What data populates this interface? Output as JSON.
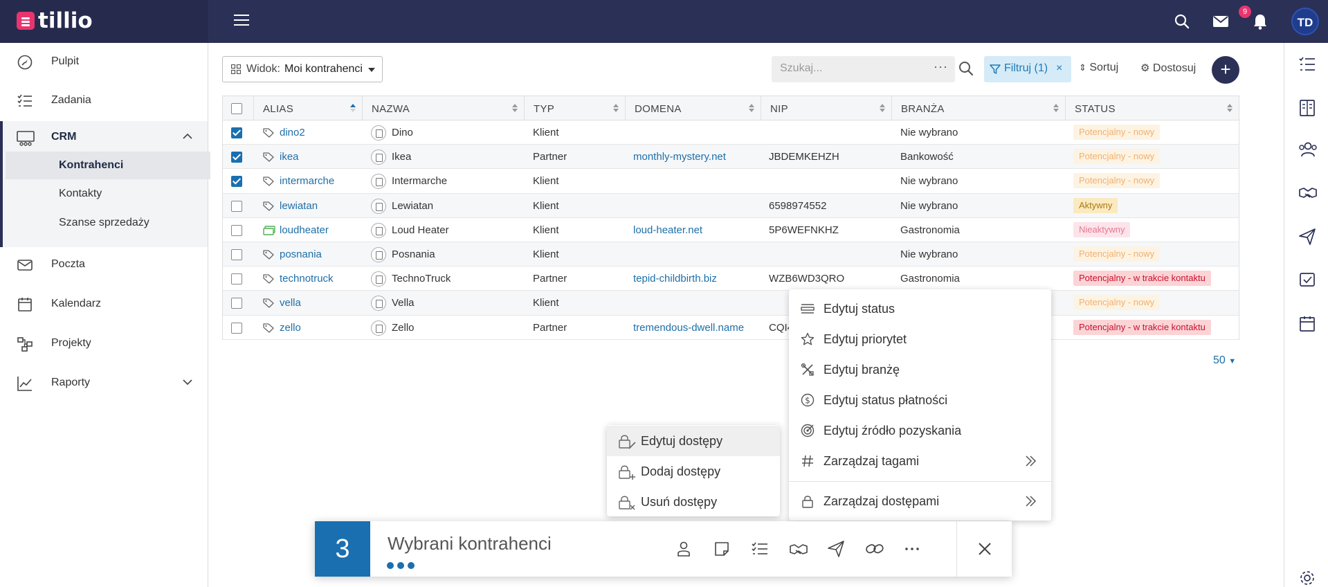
{
  "app": {
    "logo_text": "tillio",
    "notification_count": "9",
    "user_initials": "TD"
  },
  "colors": {
    "topbar": "#2b3056",
    "accent_blue": "#1a6fb0",
    "link": "#1e6fa8",
    "brand_pink": "#e8356f"
  },
  "sidebar": {
    "items": [
      {
        "label": "Pulpit",
        "icon": "compass-icon"
      },
      {
        "label": "Zadania",
        "icon": "checklist-icon"
      },
      {
        "label": "CRM",
        "icon": "crm-icon",
        "expanded": true
      },
      {
        "label": "Poczta",
        "icon": "mail-icon"
      },
      {
        "label": "Kalendarz",
        "icon": "calendar-icon"
      },
      {
        "label": "Projekty",
        "icon": "projects-icon"
      },
      {
        "label": "Raporty",
        "icon": "chart-icon"
      }
    ],
    "crm_sub": [
      {
        "label": "Kontrahenci",
        "active": true
      },
      {
        "label": "Kontakty"
      },
      {
        "label": "Szanse sprzedaży"
      }
    ]
  },
  "toolbar": {
    "view_prefix": "Widok:",
    "view_value": "Moi kontrahenci",
    "search_placeholder": "Szukaj...",
    "search_more": "···",
    "filter_label": "Filtruj (1)",
    "filter_clear": "×",
    "sort_label": "Sortuj",
    "customize_label": "Dostosuj",
    "add_label": "+"
  },
  "table": {
    "columns": [
      "ALIAS",
      "NAZWA",
      "TYP",
      "DOMENA",
      "NIP",
      "BRANŻA",
      "STATUS"
    ],
    "rows": [
      {
        "checked": true,
        "alias": "dino2",
        "name": "Dino",
        "type": "Klient",
        "domain": "",
        "nip": "",
        "industry": "Nie wybrano",
        "status": "Potencjalny - nowy",
        "status_kind": "new"
      },
      {
        "checked": true,
        "alias": "ikea",
        "name": "Ikea",
        "type": "Partner",
        "domain": "monthly-mystery.net",
        "nip": "JBDEMKEHZH",
        "industry": "Bankowość",
        "status": "Potencjalny - nowy",
        "status_kind": "new"
      },
      {
        "checked": true,
        "alias": "intermarche",
        "name": "Intermarche",
        "type": "Klient",
        "domain": "",
        "nip": "",
        "industry": "Nie wybrano",
        "status": "Potencjalny - nowy",
        "status_kind": "new"
      },
      {
        "checked": false,
        "alias": "lewiatan",
        "name": "Lewiatan",
        "type": "Klient",
        "domain": "",
        "nip": "6598974552",
        "industry": "Nie wybrano",
        "status": "Aktywny",
        "status_kind": "active"
      },
      {
        "checked": false,
        "alias": "loudheater",
        "name": "Loud Heater",
        "type": "Klient",
        "domain": "loud-heater.net",
        "nip": "5P6WEFNKHZ",
        "industry": "Gastronomia",
        "status": "Nieaktywny",
        "status_kind": "inactive",
        "alias_icon": "card-icon"
      },
      {
        "checked": false,
        "alias": "posnania",
        "name": "Posnania",
        "type": "Klient",
        "domain": "",
        "nip": "",
        "industry": "Nie wybrano",
        "status": "Potencjalny - nowy",
        "status_kind": "new"
      },
      {
        "checked": false,
        "alias": "technotruck",
        "name": "TechnoTruck",
        "type": "Partner",
        "domain": "tepid-childbirth.biz",
        "nip": "WZB6WD3QRO",
        "industry": "Gastronomia",
        "status": "Potencjalny - w trakcie kontaktu",
        "status_kind": "contact"
      },
      {
        "checked": false,
        "alias": "vella",
        "name": "Vella",
        "type": "Klient",
        "domain": "",
        "nip": "",
        "industry": "",
        "status": "Potencjalny - nowy",
        "status_kind": "new"
      },
      {
        "checked": false,
        "alias": "zello",
        "name": "Zello",
        "type": "Partner",
        "domain": "tremendous-dwell.name",
        "nip": "CQI4",
        "industry": "",
        "status": "Potencjalny - w trakcie kontaktu",
        "status_kind": "contact"
      }
    ],
    "page_size": "50"
  },
  "context_menu": {
    "items": [
      {
        "label": "Edytuj status",
        "icon": "list-icon"
      },
      {
        "label": "Edytuj priorytet",
        "icon": "star-icon"
      },
      {
        "label": "Edytuj branżę",
        "icon": "tools-icon"
      },
      {
        "label": "Edytuj status płatności",
        "icon": "dollar-circle-icon"
      },
      {
        "label": "Edytuj źródło pozyskania",
        "icon": "target-icon"
      },
      {
        "label": "Zarządzaj tagami",
        "icon": "hash-icon",
        "submenu": true
      },
      {
        "label": "Zarządzaj dostępami",
        "icon": "lock-icon",
        "submenu": true
      }
    ]
  },
  "access_submenu": {
    "items": [
      {
        "label": "Edytuj dostępy",
        "icon": "lock-edit-icon"
      },
      {
        "label": "Dodaj dostępy",
        "icon": "lock-add-icon"
      },
      {
        "label": "Usuń dostępy",
        "icon": "lock-remove-icon"
      }
    ]
  },
  "selection_bar": {
    "count": "3",
    "title": "Wybrani kontrahenci",
    "actions": [
      "person-icon",
      "note-icon",
      "tasks-icon",
      "handshake-icon",
      "send-icon",
      "link-icon",
      "more-icon"
    ]
  }
}
